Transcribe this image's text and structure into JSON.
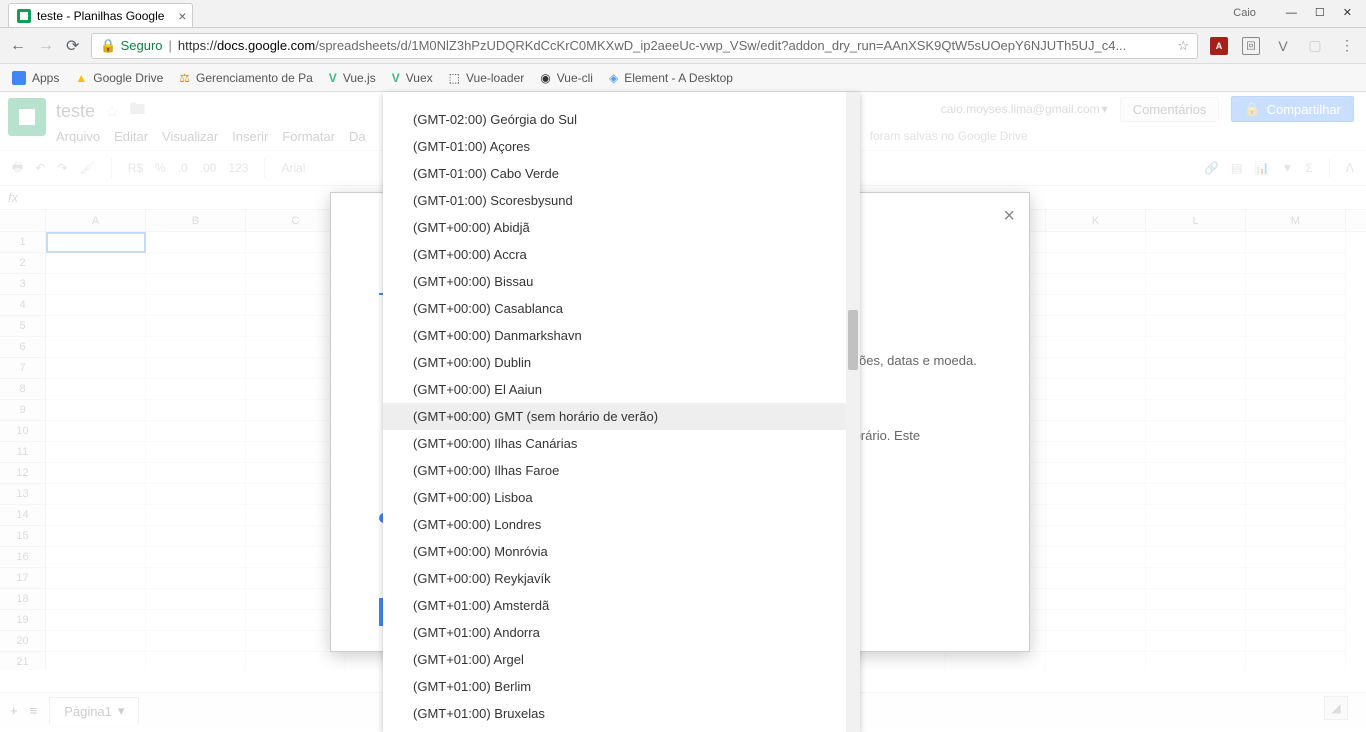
{
  "browser": {
    "tab_title": "teste - Planilhas Google",
    "profile": "Caio",
    "secure_label": "Seguro",
    "url_prefix": "https://",
    "url_host": "docs.google.com",
    "url_path": "/spreadsheets/d/1M0NlZ3hPzUDQRKdCcKrC0MKXwD_ip2aeeUc-vwp_VSw/edit?addon_dry_run=AAnXSK9QtW5sUOepY6NJUTh5UJ_c4..."
  },
  "bookmarks": [
    {
      "label": "Apps"
    },
    {
      "label": "Google Drive"
    },
    {
      "label": "Gerenciamento de Pa"
    },
    {
      "label": "Vue.js"
    },
    {
      "label": "Vuex"
    },
    {
      "label": "Vue-loader"
    },
    {
      "label": "Vue-cli"
    },
    {
      "label": "Element - A Desktop"
    }
  ],
  "sheets": {
    "doc_title": "teste",
    "menus": [
      "Arquivo",
      "Editar",
      "Visualizar",
      "Inserir",
      "Formatar",
      "Da"
    ],
    "save_status": "foram salvas no Google Drive",
    "user_email": "caio.moyses.lima@gmail.com",
    "comments_btn": "Comentários",
    "share_btn": "Compartilhar",
    "toolbar_items": [
      "R$",
      "%",
      ".0",
      ".00",
      "123",
      "Arial"
    ],
    "sheet_tab": "Página1",
    "columns": [
      "A",
      "B",
      "C",
      "",
      "",
      "",
      "",
      "",
      "",
      "",
      "K",
      "L",
      "M"
    ],
    "rows": [
      "1",
      "2",
      "3",
      "4",
      "5",
      "6",
      "7",
      "8",
      "9",
      "10",
      "11",
      "12",
      "13",
      "14",
      "15",
      "16",
      "17",
      "18",
      "19",
      "20",
      "21"
    ]
  },
  "dialog": {
    "text1": "ões, datas e moeda.",
    "text2": "so horário. Este"
  },
  "dropdown": {
    "items": [
      "(GMT-02:00) Geórgia do Sul",
      "(GMT-01:00) Açores",
      "(GMT-01:00) Cabo Verde",
      "(GMT-01:00) Scoresbysund",
      "(GMT+00:00) Abidjã",
      "(GMT+00:00) Accra",
      "(GMT+00:00) Bissau",
      "(GMT+00:00) Casablanca",
      "(GMT+00:00) Danmarkshavn",
      "(GMT+00:00) Dublin",
      "(GMT+00:00) El Aaiun",
      "(GMT+00:00) GMT (sem horário de verão)",
      "(GMT+00:00) Ilhas Canárias",
      "(GMT+00:00) Ilhas Faroe",
      "(GMT+00:00) Lisboa",
      "(GMT+00:00) Londres",
      "(GMT+00:00) Monróvia",
      "(GMT+00:00) Reykjavík",
      "(GMT+01:00) Amsterdã",
      "(GMT+01:00) Andorra",
      "(GMT+01:00) Argel",
      "(GMT+01:00) Berlim",
      "(GMT+01:00) Bruxelas"
    ],
    "highlighted_index": 11
  }
}
